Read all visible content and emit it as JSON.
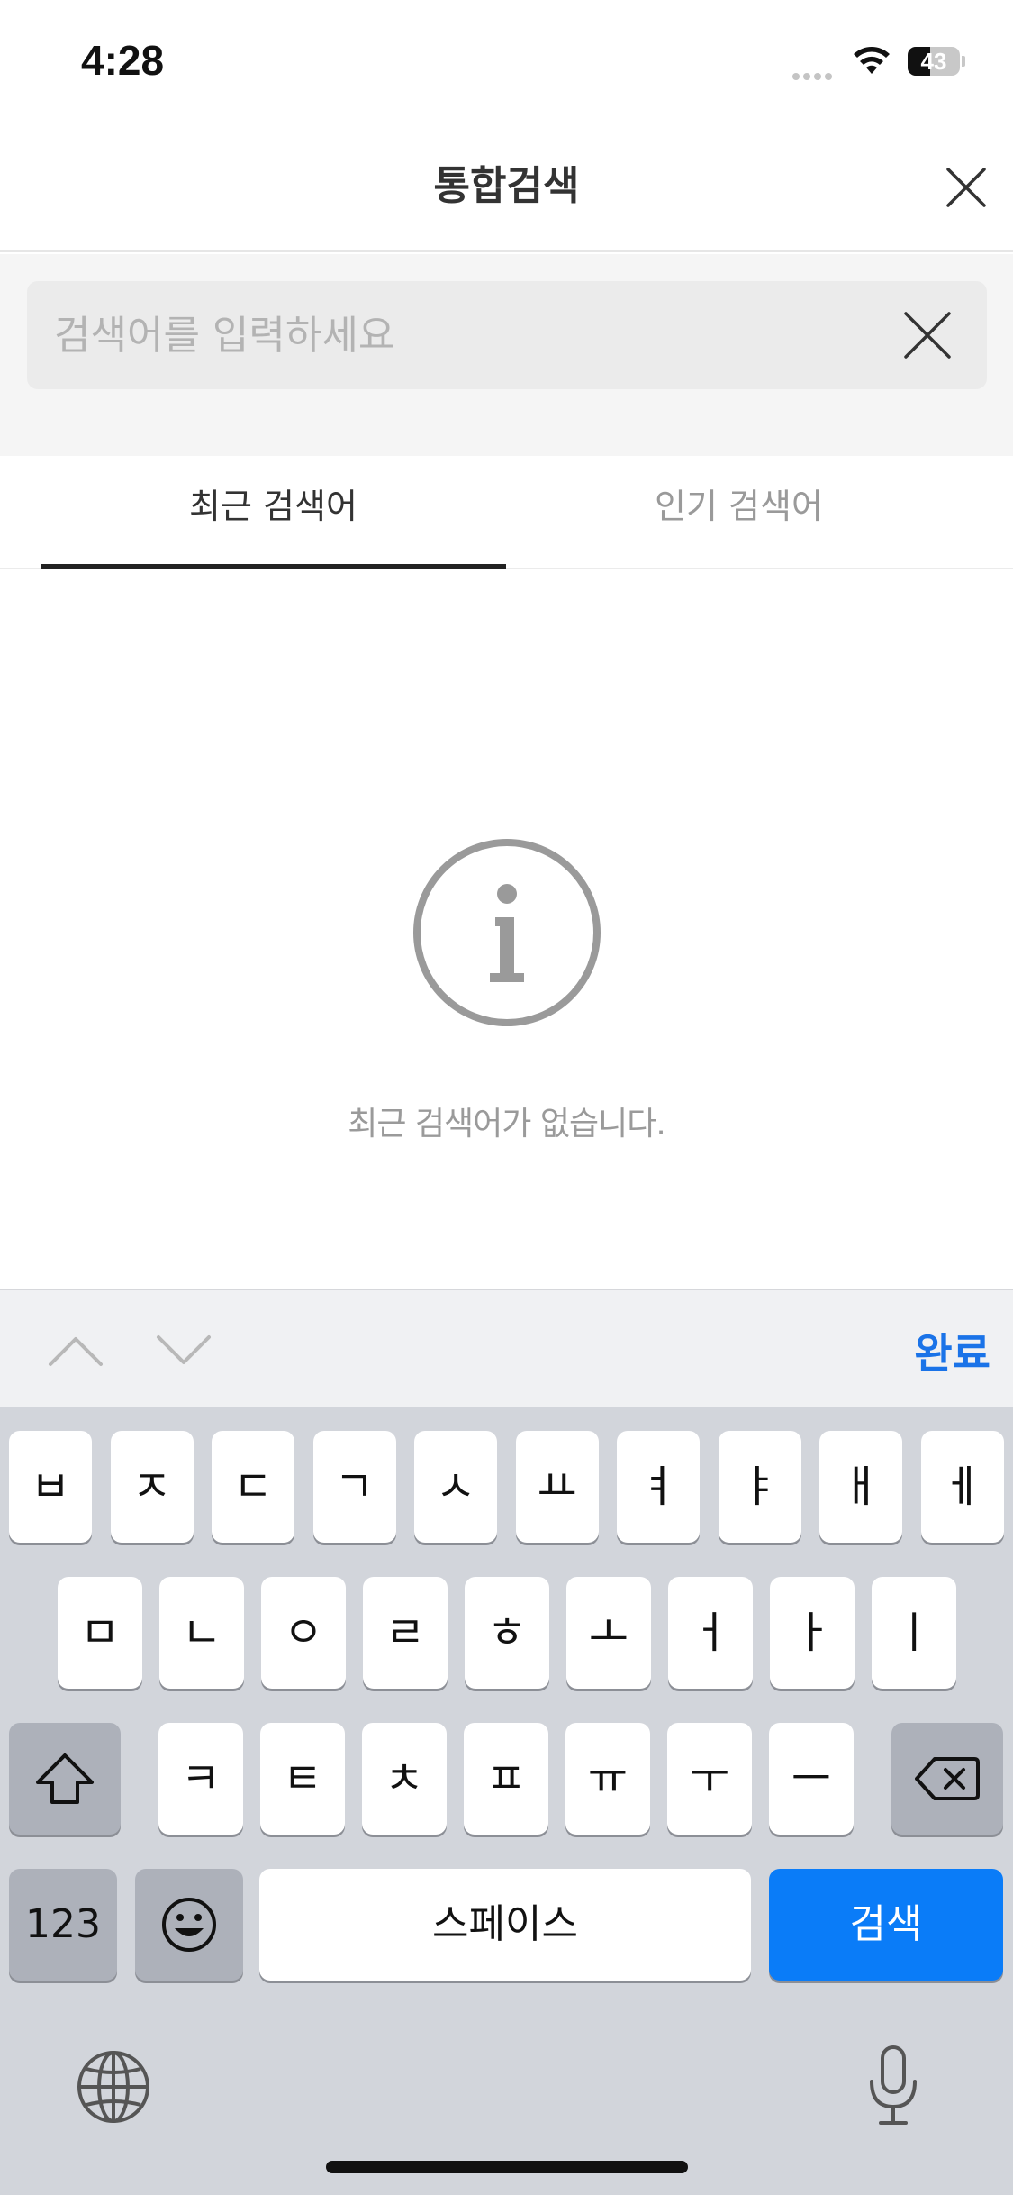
{
  "status_bar": {
    "time": "4:28",
    "battery_level": "43",
    "icons": [
      "cellular-signal-icon",
      "wifi-icon",
      "battery-icon"
    ]
  },
  "header": {
    "title": "통합검색",
    "close_icon": "close-icon"
  },
  "search": {
    "placeholder": "검색어를 입력하세요",
    "value": "",
    "clear_icon": "clear-icon"
  },
  "tabs": [
    {
      "label": "최근 검색어",
      "selected": true
    },
    {
      "label": "인기 검색어",
      "selected": false
    }
  ],
  "empty_state": {
    "icon": "info-icon",
    "message": "최근 검색어가 없습니다."
  },
  "accessory_bar": {
    "up_icon": "chevron-up-icon",
    "down_icon": "chevron-down-icon",
    "done_label": "완료"
  },
  "keyboard": {
    "row1": [
      "ㅂ",
      "ㅈ",
      "ㄷ",
      "ㄱ",
      "ㅅ",
      "ㅛ",
      "ㅕ",
      "ㅑ",
      "ㅐ",
      "ㅔ"
    ],
    "row2": [
      "ㅁ",
      "ㄴ",
      "ㅇ",
      "ㄹ",
      "ㅎ",
      "ㅗ",
      "ㅓ",
      "ㅏ",
      "ㅣ"
    ],
    "row3": [
      "ㅋ",
      "ㅌ",
      "ㅊ",
      "ㅍ",
      "ㅠ",
      "ㅜ",
      "ㅡ"
    ],
    "numbers_label": "123",
    "space_label": "스페이스",
    "search_label": "검색",
    "icons": [
      "shift-icon",
      "backspace-icon",
      "emoji-icon",
      "globe-icon",
      "microphone-icon"
    ]
  },
  "colors": {
    "accent": "#0a7cf8",
    "done": "#1a73e8",
    "keyboard_bg": "#d2d5db"
  }
}
